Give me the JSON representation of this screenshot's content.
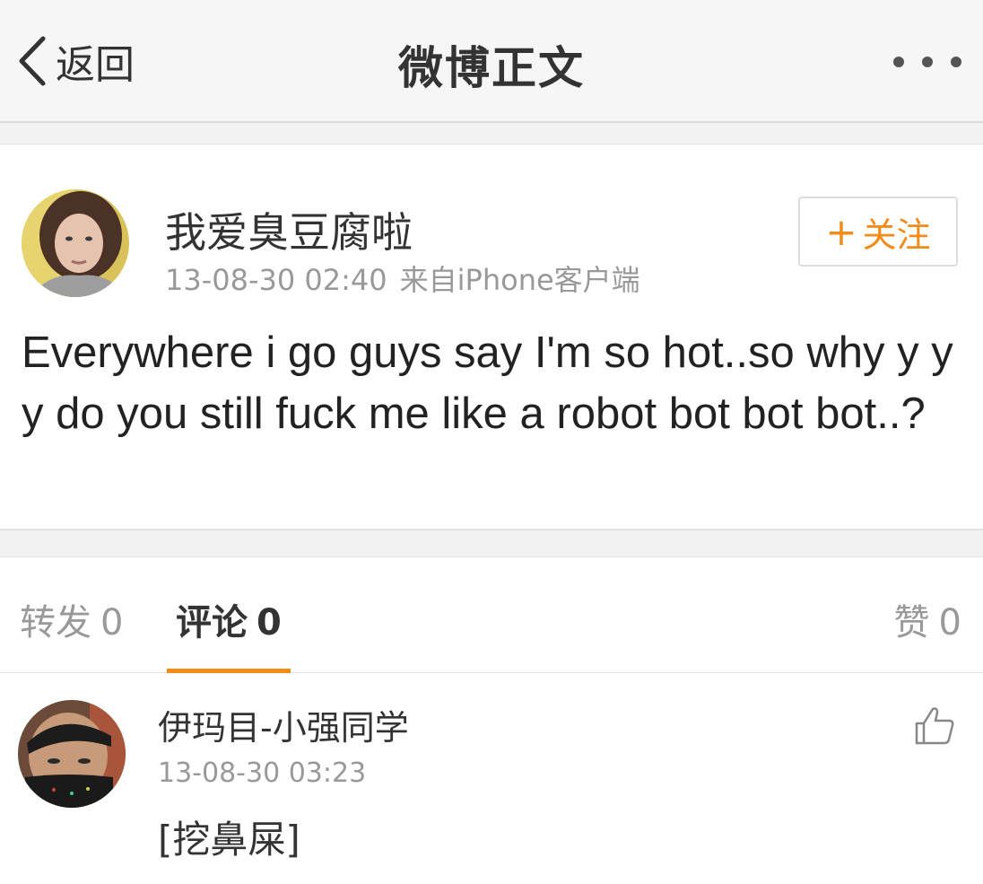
{
  "nav": {
    "back_label": "返回",
    "title": "微博正文",
    "icons": {
      "back": "chevron-left-icon",
      "more": "more-dots-icon"
    }
  },
  "post": {
    "author": "我爱臭豆腐啦",
    "time": "13-08-30 02:40",
    "source": "来自iPhone客户端",
    "follow_label": "关注",
    "text": "Everywhere i go guys say I'm so hot..so why y y y do you still fuck me like a robot bot bot bot..?"
  },
  "tabs": {
    "repost_label": "转发",
    "repost_count": "0",
    "comments_label": "评论",
    "comments_count": "0",
    "likes_label": "赞",
    "likes_count": "0"
  },
  "comments": [
    {
      "name": "伊玛目-小强同学",
      "time": "13-08-30 03:23",
      "text": "[挖鼻屎]"
    }
  ],
  "colors": {
    "accent": "#f28b1a",
    "text_primary": "#333333",
    "text_secondary": "#999999",
    "background": "#f2f2f2"
  }
}
